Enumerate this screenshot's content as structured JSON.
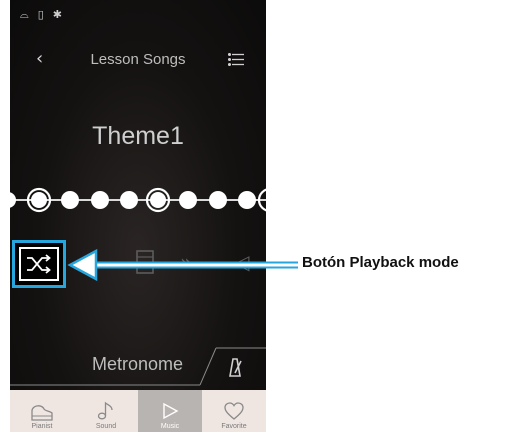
{
  "status_bar": {
    "icons": [
      "headphones-icon",
      "usb-icon",
      "bluetooth-icon"
    ],
    "glyphs": [
      "⌓",
      "▯",
      "✱"
    ]
  },
  "header": {
    "back_glyph": "‹",
    "title": "Lesson Songs",
    "menu_icon": "list-icon"
  },
  "song": {
    "title": "Theme1"
  },
  "progress_dots": {
    "count": 9,
    "outlined_index": [
      0,
      4,
      8
    ],
    "current_position": 1
  },
  "controls": {
    "items": [
      "shuffle-icon",
      "rewind-icon",
      "sheet-icon",
      "tempo-icon",
      "volume-icon"
    ],
    "playback_mode_glyph": "⤮"
  },
  "metronome": {
    "label": "Metronome",
    "icon": "metronome-icon"
  },
  "tabs": [
    {
      "label": "Pianist",
      "icon": "piano-icon",
      "active": false
    },
    {
      "label": "Sound",
      "icon": "note-icon",
      "active": false
    },
    {
      "label": "Music",
      "icon": "play-icon",
      "active": true
    },
    {
      "label": "Favorite",
      "icon": "heart-icon",
      "active": false
    }
  ],
  "annotation": {
    "label": "Botón Playback mode"
  },
  "colors": {
    "highlight": "#27a6de",
    "tab_bar": "#efe6e2",
    "tab_active": "#b8b4b2"
  }
}
